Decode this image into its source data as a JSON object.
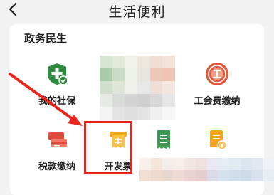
{
  "header": {
    "title": "生活便利",
    "back_icon": "chevron-left-icon"
  },
  "section": {
    "title": "政务民生"
  },
  "services": [
    {
      "label": "我的社保",
      "icon": "shield-plus-icon",
      "color": "#2e8b3d"
    },
    {
      "label": "",
      "icon": "obscured-icon",
      "color": "#cccccc"
    },
    {
      "label": "工会费缴纳",
      "icon": "union-emblem-icon",
      "color": "#e15a3a"
    },
    {
      "label": "税款缴纳",
      "icon": "tax-card-icon",
      "color": "#e04a3c"
    },
    {
      "label": "开发票",
      "icon": "invoice-icon",
      "color": "#f0a51a"
    },
    {
      "label": "",
      "icon": "receipt-list-icon",
      "color": "#3d9a52"
    },
    {
      "label": "",
      "icon": "coin-document-icon",
      "color": "#f0a51a"
    }
  ],
  "annotation": {
    "highlight_color": "#e8241c"
  }
}
